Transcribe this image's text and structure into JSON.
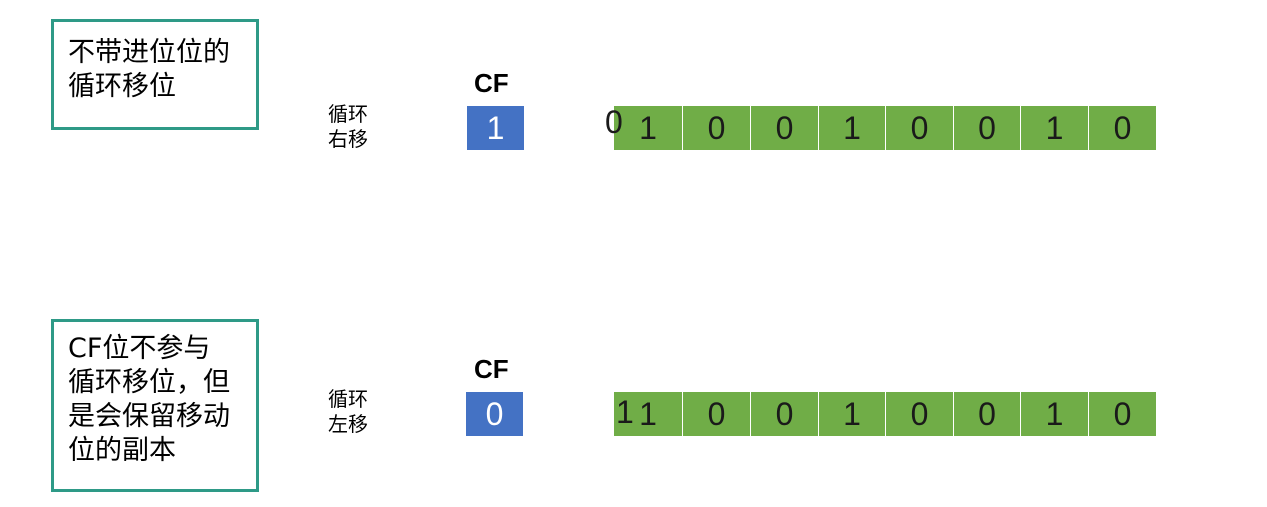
{
  "colors": {
    "note_border": "#2e9a87",
    "cf_fill": "#4472c4",
    "bit_fill": "#70ad47",
    "bit_divider": "#ffffff"
  },
  "top": {
    "note": "不带进位位的\n循环移位",
    "operation": "循环\n右移",
    "cf_label": "CF",
    "cf_value": "1",
    "moving_bit": "0",
    "bits": [
      "1",
      "0",
      "0",
      "1",
      "0",
      "0",
      "1",
      "0"
    ]
  },
  "bottom": {
    "note": "CF位不参与\n循环移位，但\n是会保留移动\n位的副本",
    "operation": "循环\n左移",
    "cf_label": "CF",
    "cf_value": "0",
    "moving_bit": "1",
    "bits": [
      "1",
      "0",
      "0",
      "1",
      "0",
      "0",
      "1",
      "0"
    ]
  }
}
